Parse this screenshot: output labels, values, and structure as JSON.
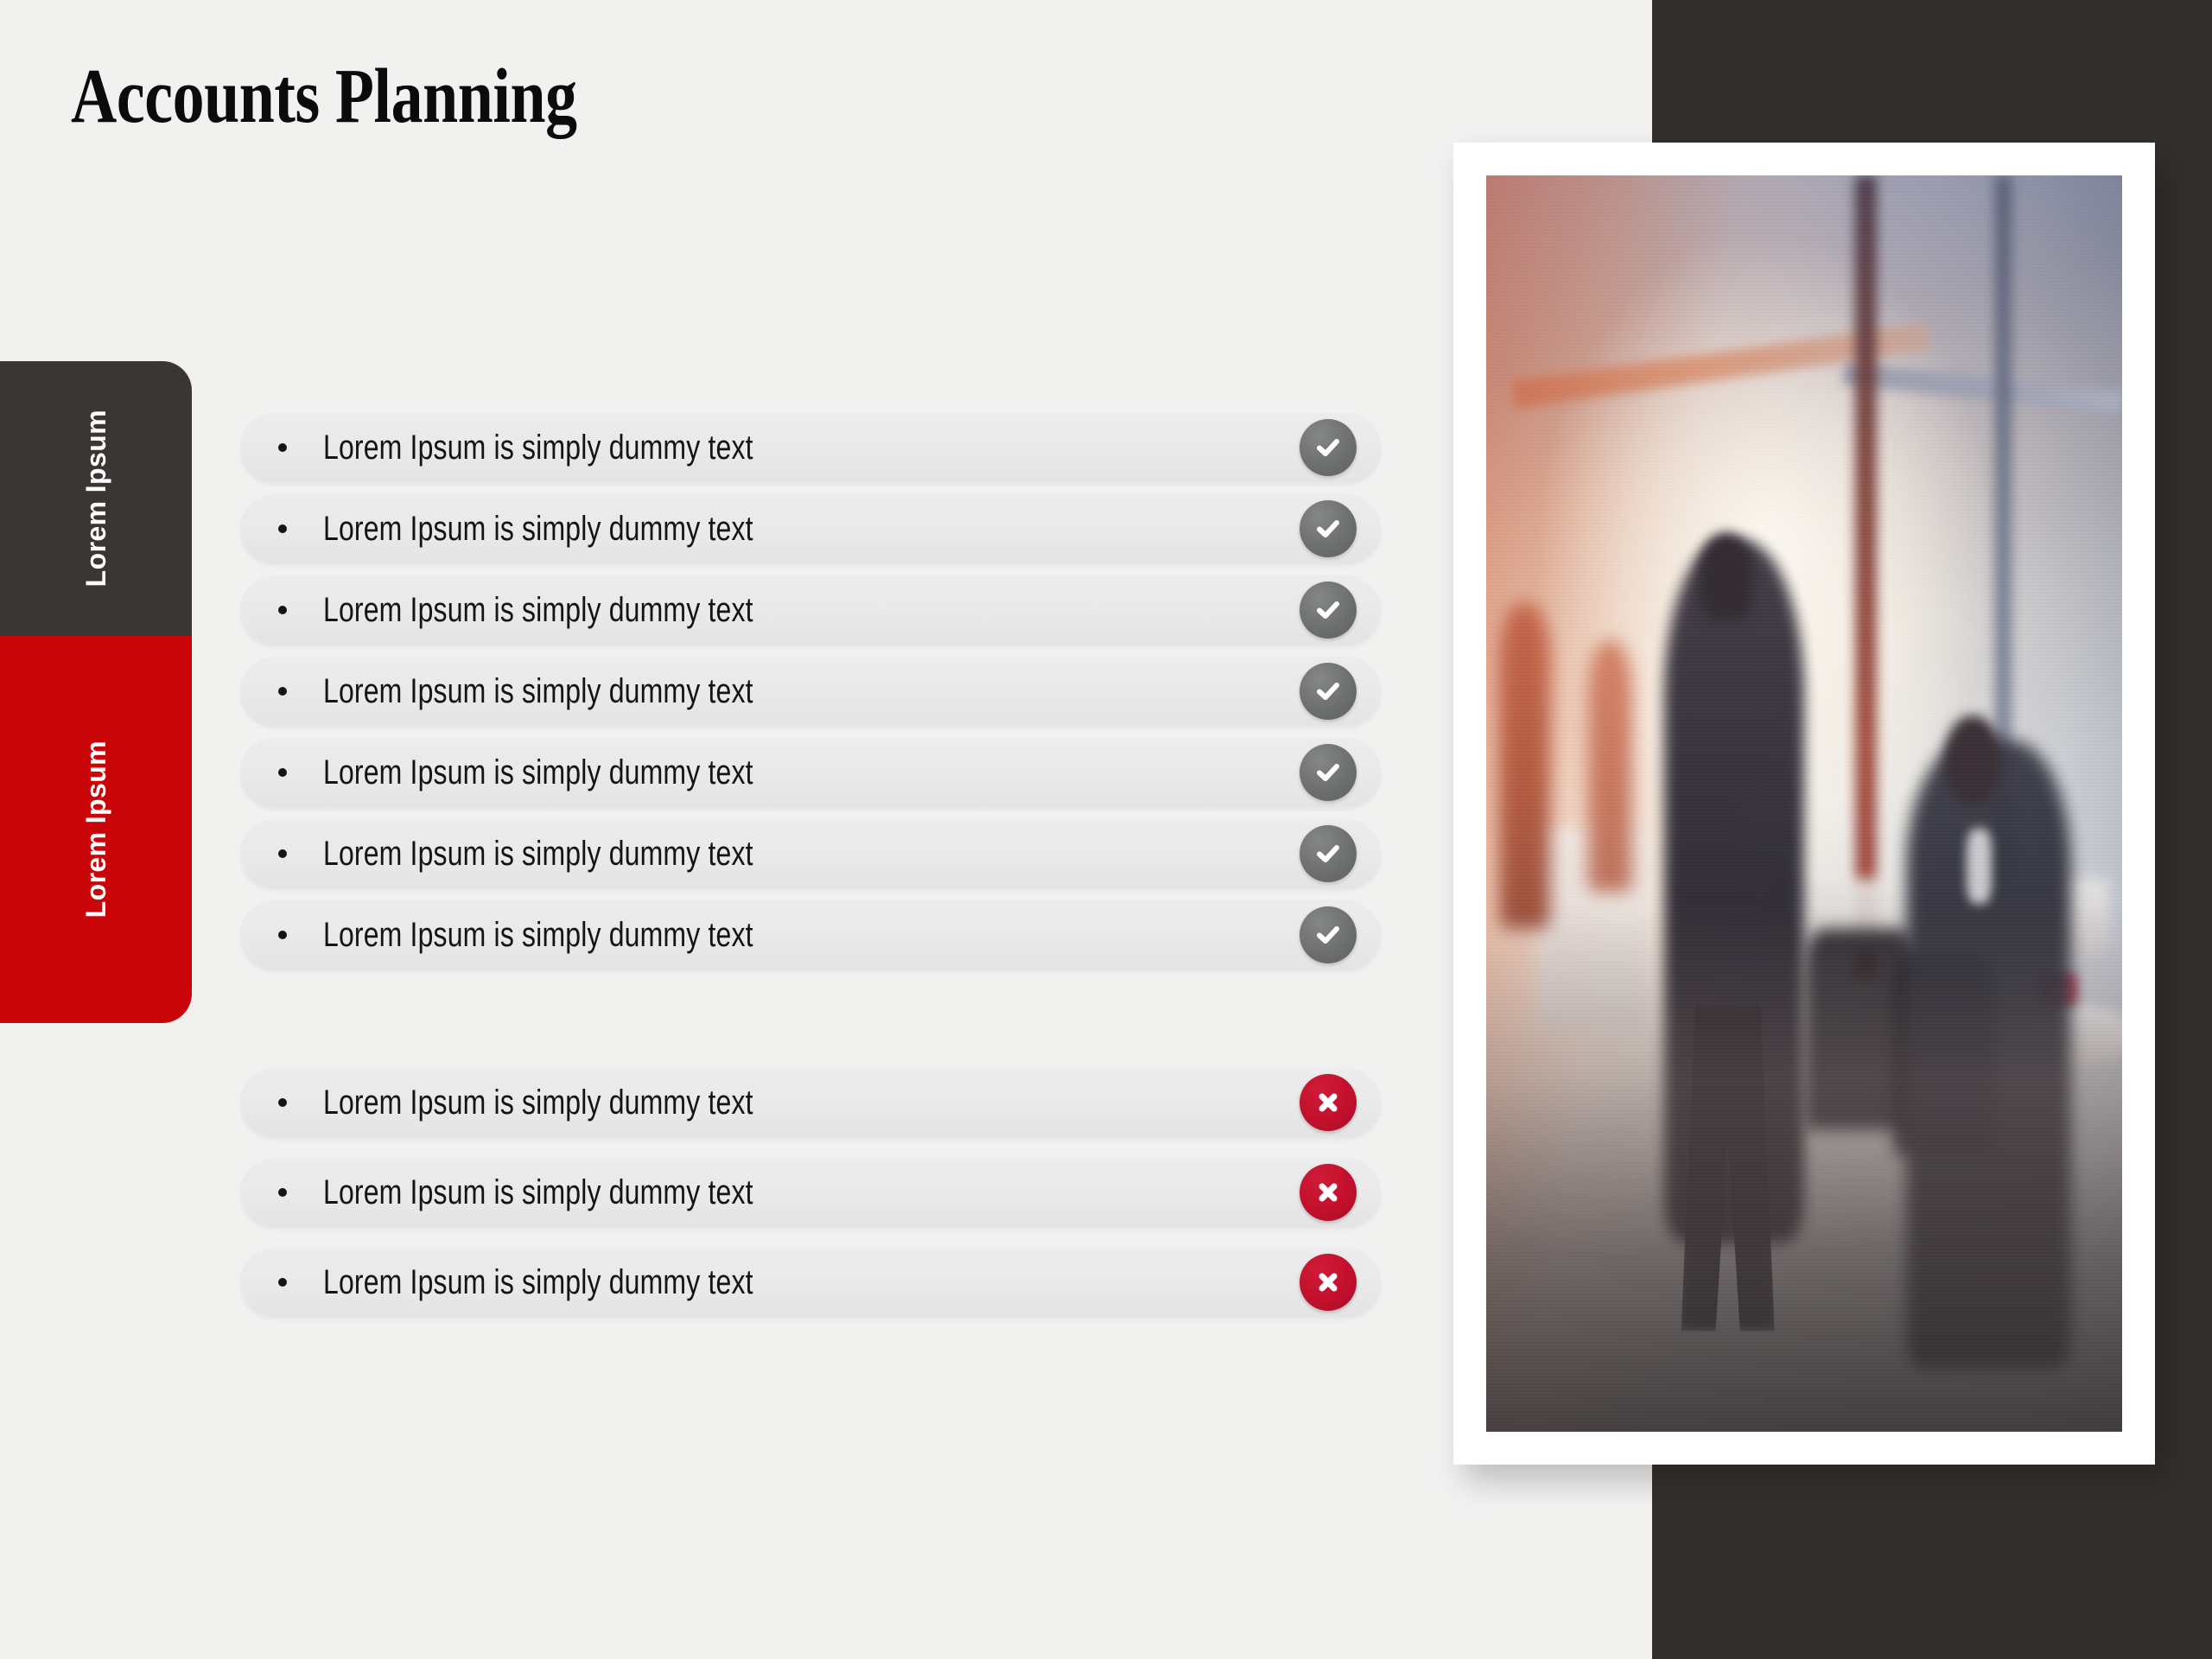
{
  "slide": {
    "title": "Accounts Planning",
    "background_color": "#f1f1f0",
    "accent_red": "#c90509",
    "accent_dark": "#332f2c"
  },
  "side_tabs": [
    {
      "label": "Lorem Ipsum",
      "style": "dark",
      "color": "#3a3633"
    },
    {
      "label": "Lorem Ipsum",
      "style": "red",
      "color": "#c90509"
    }
  ],
  "checklist": {
    "positive": {
      "icon": "check-circle-icon",
      "icon_color": "#6d706f",
      "items": [
        {
          "text": "Lorem Ipsum is simply dummy text"
        },
        {
          "text": "Lorem Ipsum is simply dummy text"
        },
        {
          "text": "Lorem Ipsum is simply dummy text"
        },
        {
          "text": "Lorem Ipsum is simply dummy text"
        },
        {
          "text": "Lorem Ipsum is simply dummy text"
        },
        {
          "text": "Lorem Ipsum is simply dummy text"
        },
        {
          "text": "Lorem Ipsum is simply dummy text"
        }
      ]
    },
    "negative": {
      "icon": "cross-circle-icon",
      "icon_color": "#c2102c",
      "items": [
        {
          "text": "Lorem Ipsum is simply dummy text"
        },
        {
          "text": "Lorem Ipsum is simply dummy text"
        },
        {
          "text": "Lorem Ipsum is simply dummy text"
        }
      ]
    }
  },
  "photo": {
    "name": "office-meeting-photo",
    "description": "Blurred modern office interior with business people walking and seated at a meeting table"
  }
}
